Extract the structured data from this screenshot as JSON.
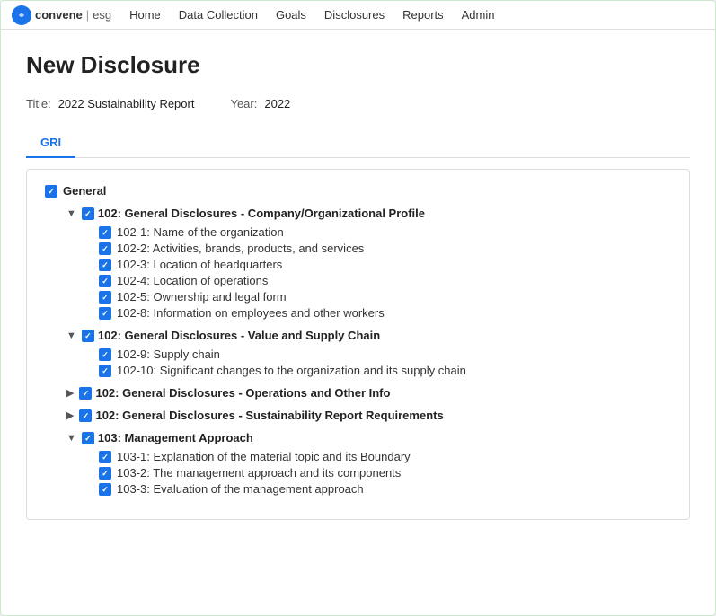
{
  "nav": {
    "logo_letter": "C",
    "logo_brand": "convene",
    "logo_sep": "|",
    "logo_sub": "esg",
    "items": [
      {
        "label": "Home",
        "id": "home"
      },
      {
        "label": "Data Collection",
        "id": "data-collection"
      },
      {
        "label": "Goals",
        "id": "goals"
      },
      {
        "label": "Disclosures",
        "id": "disclosures"
      },
      {
        "label": "Reports",
        "id": "reports"
      },
      {
        "label": "Admin",
        "id": "admin"
      }
    ]
  },
  "page": {
    "title": "New Disclosure",
    "title_label": "Title:",
    "title_value": "2022 Sustainability Report",
    "year_label": "Year:",
    "year_value": "2022"
  },
  "tabs": [
    {
      "label": "GRI",
      "active": true
    }
  ],
  "general": {
    "label": "General",
    "sections": [
      {
        "id": "s1",
        "expanded": true,
        "title": "102: General Disclosures - Company/Organizational Profile",
        "items": [
          "102-1: Name of the organization",
          "102-2: Activities, brands, products, and services",
          "102-3: Location of headquarters",
          "102-4: Location of operations",
          "102-5: Ownership and legal form",
          "102-8: Information on employees and other workers"
        ]
      },
      {
        "id": "s2",
        "expanded": true,
        "title": "102: General Disclosures - Value and Supply Chain",
        "items": [
          "102-9: Supply chain",
          "102-10: Significant changes to the organization and its supply chain"
        ]
      },
      {
        "id": "s3",
        "expanded": false,
        "title": "102: General Disclosures - Operations and Other Info",
        "items": []
      },
      {
        "id": "s4",
        "expanded": false,
        "title": "102: General Disclosures - Sustainability Report Requirements",
        "items": []
      },
      {
        "id": "s5",
        "expanded": true,
        "title": "103: Management Approach",
        "items": [
          "103-1: Explanation of the material topic and its Boundary",
          "103-2: The management approach and its components",
          "103-3: Evaluation of the management approach"
        ]
      }
    ]
  }
}
